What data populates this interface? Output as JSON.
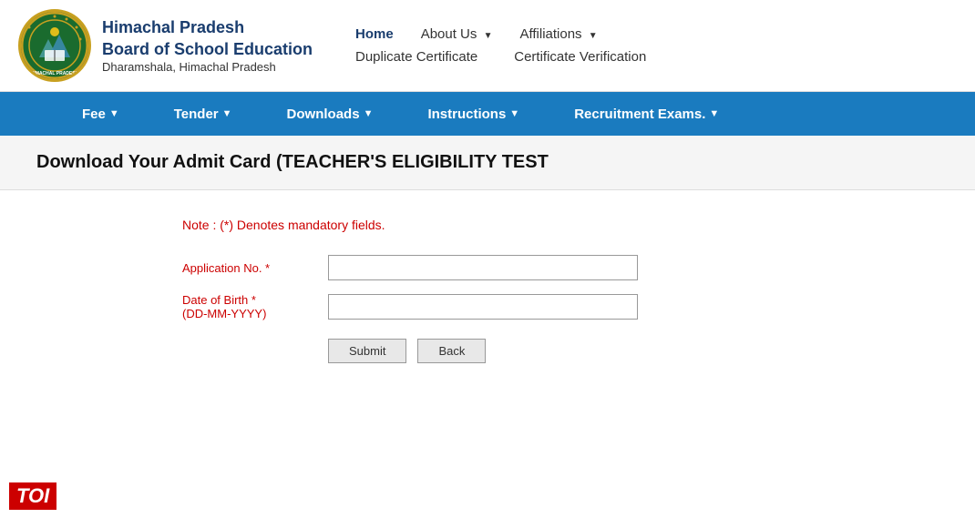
{
  "header": {
    "org_line1": "Himachal Pradesh",
    "org_line2": "Board of School Education",
    "org_line3": "Dharamshala, Himachal Pradesh",
    "nav_top": [
      {
        "id": "home",
        "label": "Home",
        "dropdown": false,
        "active": true
      },
      {
        "id": "about",
        "label": "About Us",
        "dropdown": true,
        "active": false
      },
      {
        "id": "affiliations",
        "label": "Affiliations",
        "dropdown": true,
        "active": false
      }
    ],
    "nav_bottom": [
      {
        "id": "dup-cert",
        "label": "Duplicate Certificate",
        "dropdown": false
      },
      {
        "id": "cert-verify",
        "label": "Certificate Verification",
        "dropdown": false
      }
    ]
  },
  "blue_nav": [
    {
      "id": "fee",
      "label": "Fee",
      "dropdown": true
    },
    {
      "id": "tender",
      "label": "Tender",
      "dropdown": true
    },
    {
      "id": "downloads",
      "label": "Downloads",
      "dropdown": true
    },
    {
      "id": "instructions",
      "label": "Instructions",
      "dropdown": true
    },
    {
      "id": "recruitment",
      "label": "Recruitment Exams.",
      "dropdown": true
    }
  ],
  "page": {
    "title": "Download Your Admit Card (TEACHER'S ELIGIBILITY TEST"
  },
  "form": {
    "note": "Note : (*) Denotes mandatory fields.",
    "fields": [
      {
        "id": "app-no",
        "label": "Application No. *",
        "sublabel": null,
        "placeholder": ""
      },
      {
        "id": "dob",
        "label": "Date of Birth *",
        "sublabel": "(DD-MM-YYYY)",
        "placeholder": ""
      }
    ],
    "submit_label": "Submit",
    "back_label": "Back"
  },
  "toi": {
    "label": "TOI"
  }
}
